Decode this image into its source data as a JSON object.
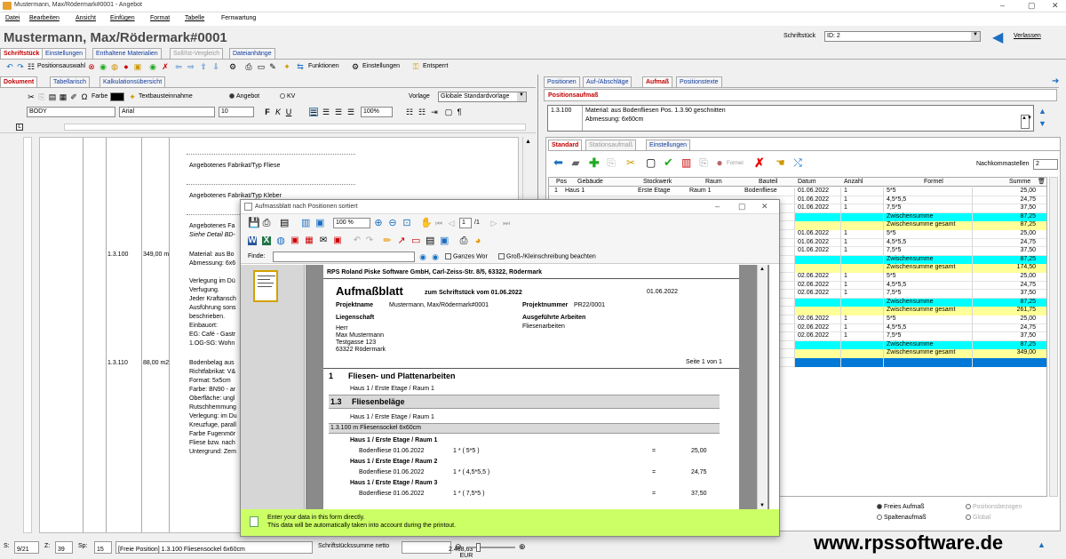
{
  "window": {
    "title": "Mustermann, Max/Rödermark#0001 - Angebot"
  },
  "menu": [
    "Datei",
    "Bearbeiten",
    "Ansicht",
    "Einfügen",
    "Format",
    "Tabelle",
    "Fernwartung"
  ],
  "header": {
    "title": "Mustermann, Max/Rödermark#0001",
    "schriftstueck_label": "Schriftstück",
    "schriftstueck_value": "ID: 2",
    "leave_label": "Verlassen"
  },
  "main_tabs": [
    "Schriftstück",
    "Einstellungen",
    "Enthaltene Materialien",
    "Soll/Ist-Vergleich",
    "Dateianhänge"
  ],
  "toolbar": {
    "positionsauswahl": "Positionsauswahl",
    "funktionen": "Funktionen",
    "einstellungen": "Einstellungen",
    "entsperrt": "Entsperrt"
  },
  "doc_tabs": [
    "Dokument",
    "Tabellarisch",
    "Kalkulationsübersicht"
  ],
  "format_bar": {
    "farbe": "Farbe",
    "textbaustein": "Textbausteinnahme",
    "angebot": "Angebot",
    "kv": "KV",
    "vorlage_label": "Vorlage",
    "vorlage_value": "Globale Standardvorlage",
    "style": "BODY",
    "font": "Arial",
    "size": "10",
    "zoom": "100%"
  },
  "doc_rows": [
    {
      "text": "Angebotenes Fabrikat/Typ Fliese"
    },
    {
      "text": "Angebotenes Fabrikat/Typ Kleber"
    },
    {
      "text": "Angebotenes Fa"
    },
    {
      "text": "Siehe Detail BD-"
    },
    {
      "pos": "1.3.100",
      "qty": "349,00 m",
      "text": "Material: aus Bo"
    },
    {
      "text": "Abmessung: 6x6"
    },
    {
      "text": "Verlegung im Dü"
    },
    {
      "text": "Verfugung."
    },
    {
      "text": "Jeder Kraftansch"
    },
    {
      "text": "Ausführung sons"
    },
    {
      "text": "beschrieben."
    },
    {
      "text": "Einbauort:"
    },
    {
      "text": "EG: Café - Gastr"
    },
    {
      "text": "1.OG-SG: Wohn"
    },
    {
      "pos": "1.3.110",
      "qty": "88,00 m2",
      "text": "Bodenbelag aus"
    },
    {
      "text": "Richtfabrikat: V&"
    },
    {
      "text": "Format: 5x5cm"
    },
    {
      "text": "Farbe: BN90 - ar"
    },
    {
      "text": "Oberfläche: ungl"
    },
    {
      "text": "Rutschhemmung"
    },
    {
      "text": "Verlegung: im Du"
    },
    {
      "text": "Kreuzfuge, parall"
    },
    {
      "text": "Farbe Fugenmör"
    },
    {
      "text": "Fliese bzw. nach"
    },
    {
      "text": "Untergrund: Zem"
    }
  ],
  "right_tabs": [
    "Positionen",
    "Auf-/Abschläge",
    "Aufmaß",
    "Positionstexte"
  ],
  "aufmass": {
    "header": "Positionsaufmaß",
    "pos": "1.3.100",
    "desc1": "Material: aus Bodenfliesen Pos. 1.3.90 geschnitten",
    "desc2": "Abmessung: 6x60cm",
    "sub_tabs": [
      "Standard",
      "Stationsaufmaß",
      "Einstellungen"
    ],
    "formel_label": "Formel",
    "nachkomma_label": "Nachkommastellen",
    "nachkomma_value": "2",
    "columns": [
      "Pos",
      "Gebäude",
      "Stockwerk",
      "Raum",
      "Bauteil",
      "Datum",
      "Anzahl",
      "Formel",
      "Summe"
    ],
    "rows": [
      {
        "pos": "1",
        "geb": "Haus 1",
        "stock": "Erste Etage",
        "raum": "Raum 1",
        "bauteil": "Bodenfliese",
        "datum": "01.06.2022",
        "anzahl": "1",
        "formel": "5*5",
        "summe": "25,00",
        "type": "data"
      },
      {
        "datum": "01.06.2022",
        "anzahl": "1",
        "formel": "4,5*5,5",
        "summe": "24,75",
        "type": "data"
      },
      {
        "datum": "01.06.2022",
        "anzahl": "1",
        "formel": "7,5*5",
        "summe": "37,50",
        "type": "data"
      },
      {
        "formel": "Zwischensumme",
        "summe": "87,25",
        "type": "cyan"
      },
      {
        "formel": "Zwischensumme gesamt",
        "summe": "87,25",
        "type": "yellow"
      },
      {
        "datum": "01.06.2022",
        "anzahl": "1",
        "formel": "5*5",
        "summe": "25,00",
        "type": "data"
      },
      {
        "datum": "01.06.2022",
        "anzahl": "1",
        "formel": "4,5*5,5",
        "summe": "24,75",
        "type": "data"
      },
      {
        "datum": "01.06.2022",
        "anzahl": "1",
        "formel": "7,5*5",
        "summe": "37,50",
        "type": "data"
      },
      {
        "formel": "Zwischensumme",
        "summe": "87,25",
        "type": "cyan"
      },
      {
        "formel": "Zwischensumme gesamt",
        "summe": "174,50",
        "type": "yellow"
      },
      {
        "datum": "02.06.2022",
        "anzahl": "1",
        "formel": "5*5",
        "summe": "25,00",
        "type": "data"
      },
      {
        "datum": "02.06.2022",
        "anzahl": "1",
        "formel": "4,5*5,5",
        "summe": "24,75",
        "type": "data"
      },
      {
        "datum": "02.06.2022",
        "anzahl": "1",
        "formel": "7,5*5",
        "summe": "37,50",
        "type": "data"
      },
      {
        "formel": "Zwischensumme",
        "summe": "87,25",
        "type": "cyan"
      },
      {
        "formel": "Zwischensumme gesamt",
        "summe": "261,75",
        "type": "yellow"
      },
      {
        "datum": "02.06.2022",
        "anzahl": "1",
        "formel": "5*5",
        "summe": "25,00",
        "type": "data"
      },
      {
        "datum": "02.06.2022",
        "anzahl": "1",
        "formel": "4,5*5,5",
        "summe": "24,75",
        "type": "data"
      },
      {
        "datum": "02.06.2022",
        "anzahl": "1",
        "formel": "7,5*5",
        "summe": "37,50",
        "type": "data"
      },
      {
        "formel": "Zwischensumme",
        "summe": "87,25",
        "type": "cyan"
      },
      {
        "formel": "Zwischensumme gesamt",
        "summe": "349,00",
        "type": "yellow"
      },
      {
        "type": "selected"
      }
    ],
    "radio": {
      "freies": "Freies Aufmaß",
      "positionsbezogen": "Positionsbezogen",
      "spalten": "Spaltenaufmaß",
      "global": "Global"
    }
  },
  "dialog": {
    "title": "Aufmassblatt nach Positionen sortiert",
    "zoom": "100 %",
    "page": "1",
    "page_total": "/1",
    "finde_label": "Finde:",
    "ganzes_wort": "Ganzes Wor",
    "gross_klein": "Groß-/Kleinschreibung beachten",
    "report": {
      "company": "RPS Roland Piske Software GmbH,  Carl-Zeiss-Str. 8/5, 63322, Rödermark",
      "heading": "Aufmaßblatt",
      "subheading": "zum Schriftstück  vom 01.06.2022",
      "date": "01.06.2022",
      "projektname_label": "Projektname",
      "projektname": "Mustermann, Max/Rödermark#0001",
      "projektnummer_label": "Projektnummer",
      "projektnummer": "PR22/0001",
      "liegenschaft_label": "Liegenschaft",
      "arbeiten_label": "Ausgeführte Arbeiten",
      "arbeiten": "Fliesenarbeiten",
      "addr": [
        "Herr",
        "Max Mustermann",
        "Testgasse 123",
        "63322 Rödermark"
      ],
      "seite": "Seite 1 von 1",
      "sec1_num": "1",
      "sec1": "Fliesen- und Plattenarbeiten",
      "sec1_loc": "Haus 1 / Erste Etage / Raum 1",
      "sec2_num": "1.3",
      "sec2": "Fliesenbeläge",
      "sec2_loc": "Haus 1 / Erste Etage / Raum 1",
      "pos_line": "1.3.100     m  Fliesensockel 6x60cm",
      "lines": [
        {
          "loc": "Haus 1 / Erste Etage / Raum 1",
          "item": "Bodenfliese 01.06.2022",
          "formula": "1 * ( 5*5 )",
          "eq": "=",
          "val": "25,00"
        },
        {
          "loc": "Haus 1 / Erste Etage / Raum 2",
          "item": "Bodenfliese 01.06.2022",
          "formula": "1 * ( 4,5*5,5 )",
          "eq": "=",
          "val": "24,75"
        },
        {
          "loc": "Haus 1 / Erste Etage / Raum 3",
          "item": "Bodenfliese 01.06.2022",
          "formula": "1 * ( 7,5*5 )",
          "eq": "=",
          "val": "37,50"
        }
      ]
    },
    "hint1": "Enter your data in this form directly.",
    "hint2": "This data will be automatically taken into account during the printout."
  },
  "status": {
    "s_label": "S:",
    "s_val": "9/21",
    "z_label": "Z:",
    "z_val": "39",
    "sp_label": "Sp:",
    "sp_val": "15",
    "pos": "[Freie Position]  1.3.100 Fliesensockel 6x60cm",
    "summe_label": "Schriftstückssumme netto",
    "summe": "2.468,63 EUR"
  },
  "watermark": "www.rpssoftware.de"
}
